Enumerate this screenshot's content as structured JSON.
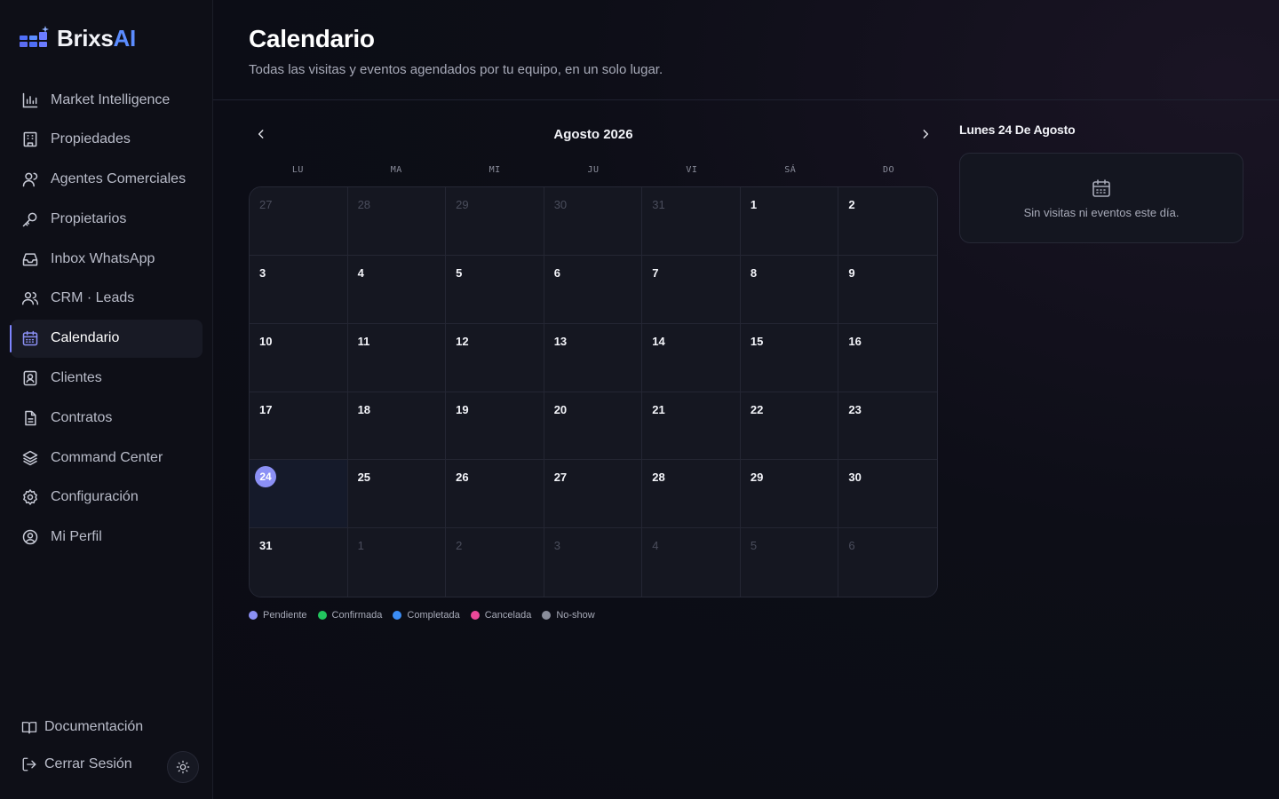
{
  "brand": {
    "part1": "Brixs",
    "part2": "AI"
  },
  "sidebar": {
    "items": [
      {
        "label": "Market Intelligence",
        "icon": "bar-chart-icon"
      },
      {
        "label": "Propiedades",
        "icon": "building-icon"
      },
      {
        "label": "Agentes Comerciales",
        "icon": "user-icon"
      },
      {
        "label": "Propietarios",
        "icon": "key-icon"
      },
      {
        "label": "Inbox WhatsApp",
        "icon": "inbox-icon"
      },
      {
        "label": "CRM · Leads",
        "icon": "users-icon"
      },
      {
        "label": "Calendario",
        "icon": "calendar-icon",
        "active": true
      },
      {
        "label": "Clientes",
        "icon": "contact-icon"
      },
      {
        "label": "Contratos",
        "icon": "document-icon"
      },
      {
        "label": "Command Center",
        "icon": "layers-icon"
      },
      {
        "label": "Configuración",
        "icon": "gear-icon"
      },
      {
        "label": "Mi Perfil",
        "icon": "profile-icon"
      }
    ],
    "docs_label": "Documentación",
    "logout_label": "Cerrar Sesión"
  },
  "header": {
    "title": "Calendario",
    "subtitle": "Todas las visitas y eventos agendados por tu equipo, en un solo lugar."
  },
  "calendar": {
    "month_label": "Agosto 2026",
    "weekdays": [
      "LU",
      "MA",
      "MI",
      "JU",
      "VI",
      "SÁ",
      "DO"
    ],
    "days": [
      {
        "n": "27",
        "muted": true
      },
      {
        "n": "28",
        "muted": true
      },
      {
        "n": "29",
        "muted": true
      },
      {
        "n": "30",
        "muted": true
      },
      {
        "n": "31",
        "muted": true
      },
      {
        "n": "1"
      },
      {
        "n": "2"
      },
      {
        "n": "3"
      },
      {
        "n": "4"
      },
      {
        "n": "5"
      },
      {
        "n": "6"
      },
      {
        "n": "7"
      },
      {
        "n": "8"
      },
      {
        "n": "9"
      },
      {
        "n": "10"
      },
      {
        "n": "11"
      },
      {
        "n": "12"
      },
      {
        "n": "13"
      },
      {
        "n": "14"
      },
      {
        "n": "15"
      },
      {
        "n": "16"
      },
      {
        "n": "17"
      },
      {
        "n": "18"
      },
      {
        "n": "19"
      },
      {
        "n": "20"
      },
      {
        "n": "21"
      },
      {
        "n": "22"
      },
      {
        "n": "23"
      },
      {
        "n": "24",
        "today": true
      },
      {
        "n": "25"
      },
      {
        "n": "26"
      },
      {
        "n": "27"
      },
      {
        "n": "28"
      },
      {
        "n": "29"
      },
      {
        "n": "30"
      },
      {
        "n": "31"
      },
      {
        "n": "1",
        "muted": true
      },
      {
        "n": "2",
        "muted": true
      },
      {
        "n": "3",
        "muted": true
      },
      {
        "n": "4",
        "muted": true
      },
      {
        "n": "5",
        "muted": true
      },
      {
        "n": "6",
        "muted": true
      }
    ]
  },
  "legend": [
    {
      "label": "Pendiente",
      "color": "#8b90f5"
    },
    {
      "label": "Confirmada",
      "color": "#22c55e"
    },
    {
      "label": "Completada",
      "color": "#3b8df6"
    },
    {
      "label": "Cancelada",
      "color": "#ec4899"
    },
    {
      "label": "No-show",
      "color": "#8a8d9b"
    }
  ],
  "day_panel": {
    "title": "Lunes 24 De Agosto",
    "empty_text": "Sin visitas ni eventos este día."
  }
}
